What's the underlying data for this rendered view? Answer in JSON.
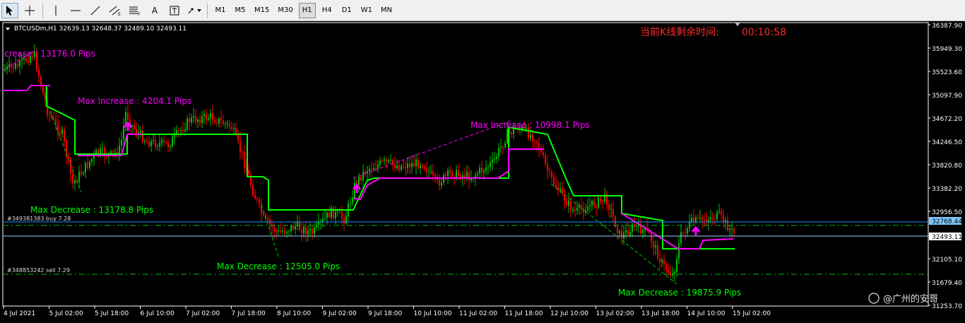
{
  "toolbar": {
    "tools": [
      {
        "name": "cursor-icon"
      },
      {
        "name": "crosshair-icon"
      },
      {
        "name": "vertical-line-icon"
      },
      {
        "name": "horizontal-line-icon"
      },
      {
        "name": "trendline-icon"
      },
      {
        "name": "equidistant-channel-icon"
      },
      {
        "name": "fibonacci-icon"
      },
      {
        "name": "text-icon",
        "label": "A"
      },
      {
        "name": "text-label-icon"
      },
      {
        "name": "arrows-icon"
      }
    ],
    "timeframes": [
      "M1",
      "M5",
      "M15",
      "M30",
      "H1",
      "H4",
      "D1",
      "W1",
      "MN"
    ],
    "active_timeframe": "H1"
  },
  "chart": {
    "symbol_info": "BTCUSDm,H1  32639.13 32648.37 32489.10 32493.11",
    "countdown_label": "当前K线剩余时间:",
    "countdown_value": "00:10:58",
    "watermark": "@广州的安哥",
    "colors": {
      "background": "#000000",
      "bull": "#00c000",
      "bear": "#ff0000",
      "up_trail": "#ff00ff",
      "down_trail": "#00ff00",
      "magenta_text": "#ff00ff",
      "green_text": "#00ff00",
      "countdown": "#ff2a2a",
      "current_price_bg": "#7fc8ff",
      "axis": "#ffffff"
    },
    "annotations": [
      {
        "id": "ann-1",
        "text": "crease : 13176.0 Pips",
        "color": "magenta"
      },
      {
        "id": "ann-2",
        "text": "Max Increase : 4204.1 Pips",
        "color": "magenta"
      },
      {
        "id": "ann-3",
        "text": "Max Increase : 10998.1 Pips",
        "color": "magenta"
      },
      {
        "id": "ann-4",
        "text": "Max Decrease : 13178.8 Pips",
        "color": "green"
      },
      {
        "id": "ann-5",
        "text": "Max Decrease : 12505.0 Pips",
        "color": "green"
      },
      {
        "id": "ann-6",
        "text": "Max Decrease : 19875.9 Pips",
        "color": "green"
      }
    ],
    "orders": [
      {
        "text": "#349381383 buy 7.28"
      },
      {
        "text": "#348853242 sell 7.29"
      }
    ],
    "price_axis": [
      "36387.90",
      "35949.30",
      "35523.60",
      "35097.90",
      "34672.20",
      "34246.50",
      "33820.80",
      "33382.20",
      "32956.50",
      "32768.44",
      "32493.11",
      "32105.10",
      "31679.40",
      "31253.70"
    ],
    "current_price_tag": "32768.44",
    "bid_price_tag": "32493.11",
    "time_axis": [
      "4 Jul 2021",
      "5 Jul 02:00",
      "5 Jul 18:00",
      "6 Jul 10:00",
      "7 Jul 02:00",
      "7 Jul 18:00",
      "8 Jul 10:00",
      "9 Jul 02:00",
      "9 Jul 18:00",
      "10 Jul 10:00",
      "11 Jul 02:00",
      "11 Jul 18:00",
      "12 Jul 10:00",
      "13 Jul 02:00",
      "13 Jul 18:00",
      "14 Jul 10:00",
      "15 Jul 02:00"
    ]
  }
}
